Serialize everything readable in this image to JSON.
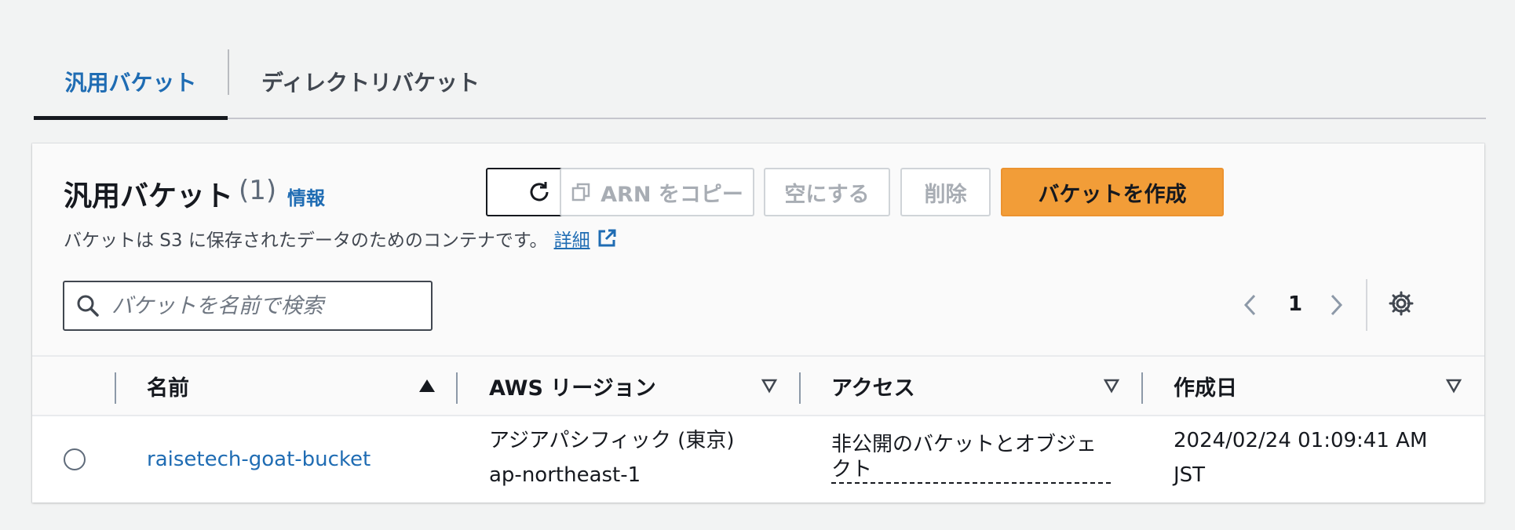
{
  "tabs": [
    {
      "label": "汎用バケット",
      "active": true
    },
    {
      "label": "ディレクトリバケット",
      "active": false
    }
  ],
  "panel": {
    "title": "汎用バケット",
    "count": "(1)",
    "info_link": "情報",
    "description": "バケットは S3 に保存されたデータのためのコンテナです。",
    "details_link": "詳細"
  },
  "toolbar": {
    "refresh_icon": "refresh-icon",
    "copy_arn_label": "ARN をコピー",
    "empty_label": "空にする",
    "delete_label": "削除",
    "create_label": "バケットを作成"
  },
  "search": {
    "placeholder": "バケットを名前で検索"
  },
  "pagination": {
    "current_page": "1"
  },
  "table": {
    "columns": [
      {
        "label": "名前",
        "sort": "ascending"
      },
      {
        "label": "AWS リージョン",
        "sort": "none"
      },
      {
        "label": "アクセス",
        "sort": "none"
      },
      {
        "label": "作成日",
        "sort": "none"
      }
    ],
    "rows": [
      {
        "name": "raisetech-goat-bucket",
        "region_name": "アジアパシフィック (東京)",
        "region_code": "ap-northeast-1",
        "access": "非公開のバケットとオブジェクト",
        "created_date": "2024/02/24 01:09:41 AM",
        "created_tz": "JST"
      }
    ]
  },
  "colors": {
    "link": "#1f6cb3",
    "primary_button": "#f29d38",
    "disabled_text": "#a8adb4"
  }
}
